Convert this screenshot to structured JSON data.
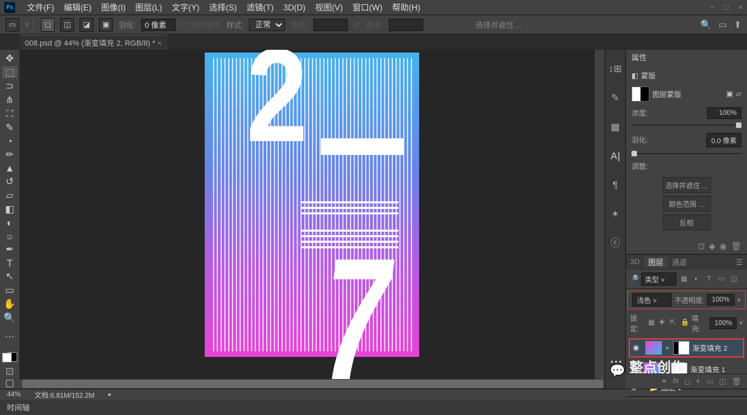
{
  "app_logo": "Ps",
  "menubar": [
    "文件(F)",
    "编辑(E)",
    "图像(I)",
    "图层(L)",
    "文字(Y)",
    "选择(S)",
    "滤镜(T)",
    "3D(D)",
    "视图(V)",
    "窗口(W)",
    "帮助(H)"
  ],
  "win_controls": [
    "−",
    "□",
    "×"
  ],
  "optionsbar": {
    "feather_label": "羽化:",
    "feather_val": "0 像素",
    "antialias": "消除锯齿",
    "style_label": "样式:",
    "style_val": "正常",
    "width_label": "宽度:",
    "height_label": "高度:",
    "select_mask": "选择并遮住 ..."
  },
  "tab": "008.psd @ 44% (渐变填充 2, RGB/8) *",
  "properties": {
    "panel_title": "属性",
    "mask_label": "蒙版",
    "layer_mask_label": "图层蒙版",
    "density_label": "浓度:",
    "density_val": "100%",
    "feather_label": "羽化:",
    "feather_val": "0.0 像素",
    "adjust_label": "调整:",
    "btn_select_mask": "选择并遮住 ...",
    "btn_color_range": "颜色范围 ...",
    "btn_invert": "反相"
  },
  "layers_panel": {
    "tab_3d": "3D",
    "tab_layers": "图层",
    "tab_channels": "通道",
    "filter_label": "类型",
    "blend_mode": "浅色",
    "opacity_label": "不透明度:",
    "opacity_val": "100%",
    "lock_label": "锁定:",
    "fill_label": "填充:",
    "fill_val": "100%",
    "layers": [
      {
        "name": "渐变填充 2",
        "highlighted": true
      },
      {
        "name": "渐变填充 1",
        "highlighted": false
      },
      {
        "name": "图层 1",
        "highlighted": false,
        "folder": true
      }
    ]
  },
  "status": {
    "zoom": "44%",
    "doc": "文档:6.81M/152.2M"
  },
  "timeline": "时间轴",
  "watermark": "整点创作"
}
